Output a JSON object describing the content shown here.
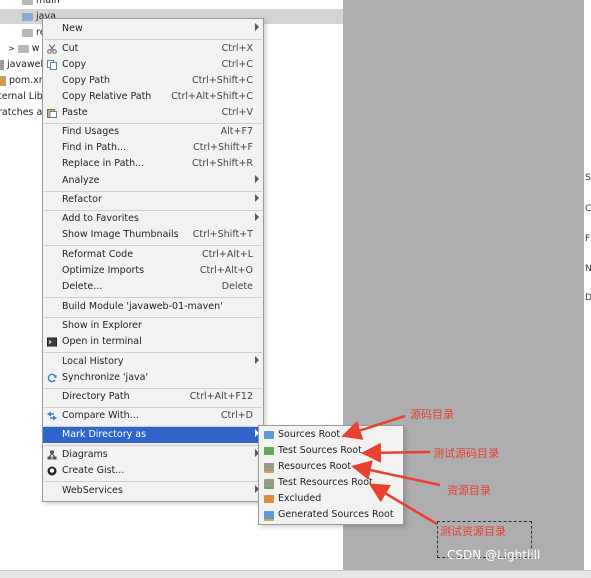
{
  "project_tree": {
    "rows": [
      {
        "text": "main"
      },
      {
        "text": "java"
      },
      {
        "text": "re"
      },
      {
        "text": "w"
      },
      {
        "text": "javaweb"
      },
      {
        "text": "pom.xm"
      },
      {
        "text": "ternal Libr"
      },
      {
        "text": "ratches an"
      }
    ]
  },
  "context_menu": {
    "items": [
      {
        "label": "New",
        "shortcut": "",
        "submenu": true,
        "icon": ""
      },
      {
        "label": "Cut",
        "shortcut": "Ctrl+X",
        "submenu": false,
        "icon": "scissors-icon"
      },
      {
        "label": "Copy",
        "shortcut": "Ctrl+C",
        "submenu": false,
        "icon": "copy-icon"
      },
      {
        "label": "Copy Path",
        "shortcut": "Ctrl+Shift+C",
        "submenu": false,
        "icon": ""
      },
      {
        "label": "Copy Relative Path",
        "shortcut": "Ctrl+Alt+Shift+C",
        "submenu": false,
        "icon": ""
      },
      {
        "label": "Paste",
        "shortcut": "Ctrl+V",
        "submenu": false,
        "icon": "paste-icon"
      },
      {
        "label": "Find Usages",
        "shortcut": "Alt+F7",
        "submenu": false,
        "icon": ""
      },
      {
        "label": "Find in Path...",
        "shortcut": "Ctrl+Shift+F",
        "submenu": false,
        "icon": ""
      },
      {
        "label": "Replace in Path...",
        "shortcut": "Ctrl+Shift+R",
        "submenu": false,
        "icon": ""
      },
      {
        "label": "Analyze",
        "shortcut": "",
        "submenu": true,
        "icon": ""
      },
      {
        "label": "Refactor",
        "shortcut": "",
        "submenu": true,
        "icon": ""
      },
      {
        "label": "Add to Favorites",
        "shortcut": "",
        "submenu": true,
        "icon": ""
      },
      {
        "label": "Show Image Thumbnails",
        "shortcut": "Ctrl+Shift+T",
        "submenu": false,
        "icon": ""
      },
      {
        "label": "Reformat Code",
        "shortcut": "Ctrl+Alt+L",
        "submenu": false,
        "icon": ""
      },
      {
        "label": "Optimize Imports",
        "shortcut": "Ctrl+Alt+O",
        "submenu": false,
        "icon": ""
      },
      {
        "label": "Delete...",
        "shortcut": "Delete",
        "submenu": false,
        "icon": ""
      },
      {
        "label": "Build Module 'javaweb-01-maven'",
        "shortcut": "",
        "submenu": false,
        "icon": ""
      },
      {
        "label": "Show in Explorer",
        "shortcut": "",
        "submenu": false,
        "icon": ""
      },
      {
        "label": "Open in terminal",
        "shortcut": "",
        "submenu": false,
        "icon": "terminal-icon"
      },
      {
        "label": "Local History",
        "shortcut": "",
        "submenu": true,
        "icon": ""
      },
      {
        "label": "Synchronize 'java'",
        "shortcut": "",
        "submenu": false,
        "icon": "sync-icon"
      },
      {
        "label": "Directory Path",
        "shortcut": "Ctrl+Alt+F12",
        "submenu": false,
        "icon": ""
      },
      {
        "label": "Compare With...",
        "shortcut": "Ctrl+D",
        "submenu": false,
        "icon": "compare-icon"
      },
      {
        "label": "Mark Directory as",
        "shortcut": "",
        "submenu": true,
        "icon": "",
        "highlighted": true
      },
      {
        "label": "Diagrams",
        "shortcut": "",
        "submenu": true,
        "icon": "diagram-icon"
      },
      {
        "label": "Create Gist...",
        "shortcut": "",
        "submenu": false,
        "icon": "github-icon"
      },
      {
        "label": "WebServices",
        "shortcut": "",
        "submenu": true,
        "icon": ""
      }
    ]
  },
  "mark_directory_submenu": {
    "items": [
      {
        "label": "Sources Root",
        "icon": "sources-root-icon",
        "color": "#5b9bd5"
      },
      {
        "label": "Test Sources Root",
        "icon": "test-sources-root-icon",
        "color": "#62a85a"
      },
      {
        "label": "Resources Root",
        "icon": "resources-root-icon",
        "color": "#9a9a8a"
      },
      {
        "label": "Test Resources Root",
        "icon": "test-resources-root-icon",
        "color": "#9a9a8a"
      },
      {
        "label": "Excluded",
        "icon": "excluded-icon",
        "color": "#e08a3c"
      },
      {
        "label": "Generated Sources Root",
        "icon": "generated-sources-root-icon",
        "color": "#5b9bd5"
      }
    ]
  },
  "annotations": {
    "sources_root": "源码目录",
    "test_sources_root": "测试源码目录",
    "resources_root": "资源目录",
    "test_resources_root": "测试资源目录"
  },
  "watermark": "CSDN @Lightllll",
  "right_edge_letters": [
    "S",
    "C",
    "F",
    "N",
    "D"
  ],
  "colors": {
    "menu_highlight": "#2f65ca",
    "annotation_red": "#e8412d",
    "editor_gray": "#aeadb0"
  }
}
